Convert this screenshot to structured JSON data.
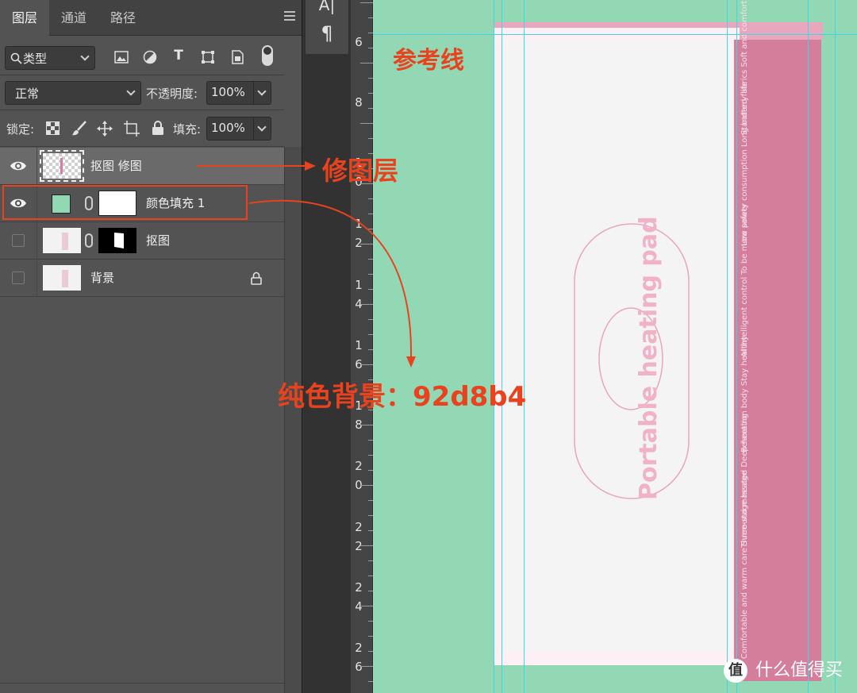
{
  "panel": {
    "tabs": [
      {
        "label": "图层"
      },
      {
        "label": "通道"
      },
      {
        "label": "路径"
      }
    ],
    "filter": {
      "kind_label": "类型"
    },
    "blend": {
      "mode": "正常",
      "opacity_label": "不透明度:",
      "opacity_value": "100%"
    },
    "lock": {
      "label": "锁定:",
      "fill_label": "填充:",
      "fill_value": "100%"
    },
    "layers": [
      {
        "name": "抠图 修图"
      },
      {
        "name": "颜色填充 1"
      },
      {
        "name": "抠图"
      },
      {
        "name": "背景"
      }
    ]
  },
  "midbar": {
    "char_glyph": "A|",
    "para_glyph": "¶"
  },
  "ruler": {
    "labels": [
      {
        "d1": "6",
        "d2": ""
      },
      {
        "d1": "8",
        "d2": ""
      },
      {
        "d1": "1",
        "d2": "0"
      },
      {
        "d1": "1",
        "d2": "2"
      },
      {
        "d1": "1",
        "d2": "4"
      },
      {
        "d1": "1",
        "d2": "6"
      },
      {
        "d1": "1",
        "d2": "8"
      },
      {
        "d1": "2",
        "d2": "0"
      },
      {
        "d1": "2",
        "d2": "2"
      },
      {
        "d1": "2",
        "d2": "4"
      },
      {
        "d1": "2",
        "d2": "6"
      }
    ]
  },
  "canvas": {
    "background_color": "#92d8b4",
    "product_text": "Portable heating pad",
    "side_lines": [
      "Standard fabrics Soft and comfortable",
      "Low power consumption Long battery life",
      "AI intelligent control To be more safety",
      "Relaxation body Stay healthy",
      "Three-stage heated Deep heating",
      "Comfortable and warm care Surround massage"
    ]
  },
  "annotations": {
    "guide_label": "参考线",
    "retouch_layer": "修图层",
    "solid_bg": "纯色背景：92d8b4",
    "accent_color": "#e8421e"
  },
  "watermark": {
    "text": "什么值得买",
    "logo_glyph": "值"
  }
}
